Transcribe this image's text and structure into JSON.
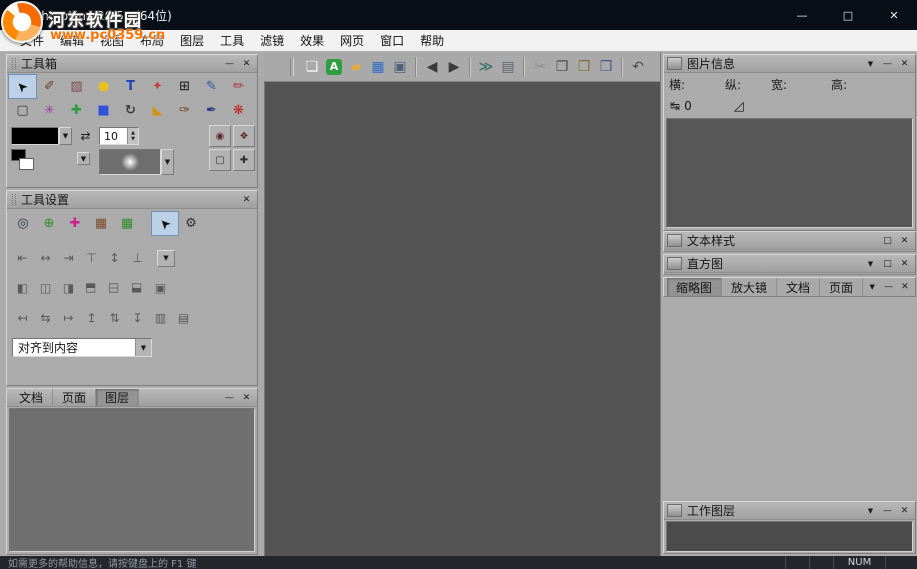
{
  "window": {
    "title": "PhotoLine 20.51 (64位)",
    "controls": {
      "minimize": "—",
      "maximize": "□",
      "close": "✕"
    }
  },
  "watermark": {
    "site_name": "河东软件园",
    "site_url": "www.pc0359.cn"
  },
  "menu": {
    "items": [
      "文件",
      "编辑",
      "视图",
      "布局",
      "图层",
      "工具",
      "滤镜",
      "效果",
      "网页",
      "窗口",
      "帮助"
    ]
  },
  "ui": {
    "minimize": "—",
    "restore": "□",
    "close": "✕",
    "dropdown": "▼",
    "swap": "⇄",
    "spin_up": "▲",
    "spin_down": "▼"
  },
  "toolbar": {
    "items": [
      {
        "name": "new-document-icon",
        "glyph": "❏",
        "color": "#f5f5f5"
      },
      {
        "name": "new-image-icon",
        "glyph": "A",
        "color": "#ffffff",
        "bg": "#2f9e40"
      },
      {
        "name": "open-file-icon",
        "glyph": "▰",
        "color": "#e2a93c"
      },
      {
        "name": "browse-images-icon",
        "glyph": "▦",
        "color": "#2e6bc8"
      },
      {
        "name": "save-icon",
        "glyph": "▣",
        "color": "#53617a"
      },
      {
        "name": "sep"
      },
      {
        "name": "back-icon",
        "glyph": "◀",
        "color": "#3b3b3b"
      },
      {
        "name": "forward-icon",
        "glyph": "▶",
        "color": "#3b3b3b"
      },
      {
        "name": "sep"
      },
      {
        "name": "export-icon",
        "glyph": "≫",
        "color": "#2c6a6a"
      },
      {
        "name": "print-icon",
        "glyph": "▤",
        "color": "#5a6470"
      },
      {
        "name": "sep"
      },
      {
        "name": "cut-icon",
        "glyph": "✂",
        "color": "#8b8b8b"
      },
      {
        "name": "copy-icon",
        "glyph": "❐",
        "color": "#4a4a4a"
      },
      {
        "name": "paste-icon",
        "glyph": "❒",
        "color": "#8a6a34"
      },
      {
        "name": "paste-as-icon",
        "glyph": "❒",
        "color": "#49598c"
      },
      {
        "name": "sep"
      },
      {
        "name": "undo-icon",
        "glyph": "↶",
        "color": "#4d4d4d"
      }
    ]
  },
  "toolbox": {
    "title": "工具箱",
    "brush_size": "10",
    "foreground_color": "#000000",
    "tools_row1": [
      {
        "name": "select-tool-icon",
        "glyph": "➤",
        "color": "#101010",
        "rot": -135,
        "selected": true
      },
      {
        "name": "lasso-tool-icon",
        "glyph": "✐",
        "color": "#6b4226"
      },
      {
        "name": "clone-stamp-tool-icon",
        "glyph": "▨",
        "color": "#7d4b4b"
      },
      {
        "name": "color-ball-tool-icon",
        "glyph": "●",
        "color": "#e8bf1e"
      },
      {
        "name": "text-tool-icon",
        "glyph": "T",
        "color": "#2244bb"
      },
      {
        "name": "transform-tool-icon",
        "glyph": "✦",
        "color": "#bf4040"
      },
      {
        "name": "crop-tool-icon",
        "glyph": "⊞",
        "color": "#2f2f2f"
      },
      {
        "name": "pen-tool-icon",
        "glyph": "✎",
        "color": "#2a58a8"
      },
      {
        "name": "eraser-tool-icon",
        "glyph": "✏",
        "color": "#b03434"
      }
    ],
    "tools_row2": [
      {
        "name": "marquee-tool-icon",
        "glyph": "▢",
        "color": "#3d3d3d"
      },
      {
        "name": "magic-wand-tool-icon",
        "glyph": "✳",
        "color": "#9a3fa8"
      },
      {
        "name": "color-picker-tool-icon",
        "glyph": "✚",
        "color": "#2f9e40"
      },
      {
        "name": "fill-layer-tool-icon",
        "glyph": "■",
        "color": "#2f52d8"
      },
      {
        "name": "rotate-tool-icon",
        "glyph": "↻",
        "color": "#3d3d3d"
      },
      {
        "name": "bucket-fill-tool-icon",
        "glyph": "◣",
        "color": "#d29418"
      },
      {
        "name": "brush-tool-icon",
        "glyph": "✑",
        "color": "#6b4a20"
      },
      {
        "name": "calligraphy-pen-tool-icon",
        "glyph": "✒",
        "color": "#243a85"
      },
      {
        "name": "airbrush-tool-icon",
        "glyph": "❋",
        "color": "#c22525"
      }
    ],
    "toggles": [
      {
        "name": "layer-visibility-toggle-icon",
        "glyph": "◉",
        "color": "#5d2424"
      },
      {
        "name": "mask-visibility-toggle-icon",
        "glyph": "❖",
        "color": "#5d2424"
      },
      {
        "name": "outline-toggle-icon",
        "glyph": "▢",
        "color": "#2f2f2f"
      },
      {
        "name": "snap-toggle-icon",
        "glyph": "✚",
        "color": "#2f2f2f"
      }
    ]
  },
  "tool_settings": {
    "title": "工具设置",
    "options": [
      {
        "name": "pick-mode-icon",
        "glyph": "◎",
        "color": "#2f3550"
      },
      {
        "name": "target-mode-icon",
        "glyph": "⊕",
        "color": "#2f8d2f"
      },
      {
        "name": "cross-mode-icon",
        "glyph": "✚",
        "color": "#cf2090"
      },
      {
        "name": "image-mode-icon",
        "glyph": "▦",
        "color": "#7d4b2b"
      },
      {
        "name": "grid-mode-icon",
        "glyph": "▦",
        "color": "#2f8d2f"
      },
      {
        "name": "select-mode-icon",
        "glyph": "➤",
        "color": "#101010",
        "rot": -135,
        "selected": true
      },
      {
        "name": "settings-gear-icon",
        "glyph": "⚙",
        "color": "#2f2f2f"
      }
    ],
    "align_row1": [
      {
        "name": "align-left-edge-icon",
        "glyph": "⇤"
      },
      {
        "name": "align-center-h-icon",
        "glyph": "↔"
      },
      {
        "name": "align-right-edge-icon",
        "glyph": "⇥"
      },
      {
        "name": "align-top-edge-icon",
        "glyph": "⊤"
      },
      {
        "name": "align-center-v-icon",
        "glyph": "↕"
      },
      {
        "name": "align-bottom-edge-icon",
        "glyph": "⊥"
      }
    ],
    "align_row2": [
      {
        "name": "align-objects-left-icon",
        "glyph": "◧"
      },
      {
        "name": "align-objects-center-h-icon",
        "glyph": "◫"
      },
      {
        "name": "align-objects-right-icon",
        "glyph": "◨"
      },
      {
        "name": "align-objects-top-icon",
        "glyph": "◧",
        "rot": 90
      },
      {
        "name": "align-objects-center-v-icon",
        "glyph": "◫",
        "rot": 90
      },
      {
        "name": "align-objects-bottom-icon",
        "glyph": "◨",
        "rot": 90
      },
      {
        "name": "align-objects-both-icon",
        "glyph": "▣"
      }
    ],
    "align_row3": [
      {
        "name": "distribute-left-icon",
        "glyph": "↤"
      },
      {
        "name": "distribute-h-icon",
        "glyph": "⇆"
      },
      {
        "name": "distribute-right-icon",
        "glyph": "↦"
      },
      {
        "name": "distribute-top-icon",
        "glyph": "↥"
      },
      {
        "name": "distribute-v-icon",
        "glyph": "⇅"
      },
      {
        "name": "distribute-bottom-icon",
        "glyph": "↧"
      },
      {
        "name": "space-evenly-h-icon",
        "glyph": "▥"
      },
      {
        "name": "space-evenly-v-icon",
        "glyph": "▤"
      }
    ],
    "align_mode": {
      "value": "对齐到内容"
    }
  },
  "doc_panel": {
    "tabs": [
      {
        "name": "tab-document",
        "label": "文档"
      },
      {
        "name": "tab-page",
        "label": "页面"
      },
      {
        "name": "tab-layers",
        "label": "图层",
        "active": true
      }
    ]
  },
  "image_info": {
    "title": "图片信息",
    "fields": [
      {
        "label": "横:"
      },
      {
        "label": "纵:"
      },
      {
        "label": "宽:"
      },
      {
        "label": "高:"
      }
    ],
    "measure_icon": "↹",
    "measure_value": "0",
    "angle_icon": "◿"
  },
  "text_style": {
    "title": "文本样式"
  },
  "histogram": {
    "title": "直方图"
  },
  "view_tabs": {
    "tabs": [
      {
        "name": "tab-thumbnail",
        "label": "缩略图",
        "active": true
      },
      {
        "name": "tab-magnifier",
        "label": "放大镜"
      },
      {
        "name": "tab-document",
        "label": "文档"
      },
      {
        "name": "tab-page",
        "label": "页面"
      }
    ]
  },
  "work_layers": {
    "title": "工作图层"
  },
  "statusbar": {
    "help_text": "如需更多的帮助信息，请按键盘上的 F1 键",
    "num_label": "NUM"
  },
  "colors": {
    "titlebar_bg": "#0a0e16",
    "panel_bg": "#ababab",
    "canvas_bg": "#545454",
    "selection_highlight": "#bcd1e8",
    "watermark_orange": "#ff7300"
  }
}
